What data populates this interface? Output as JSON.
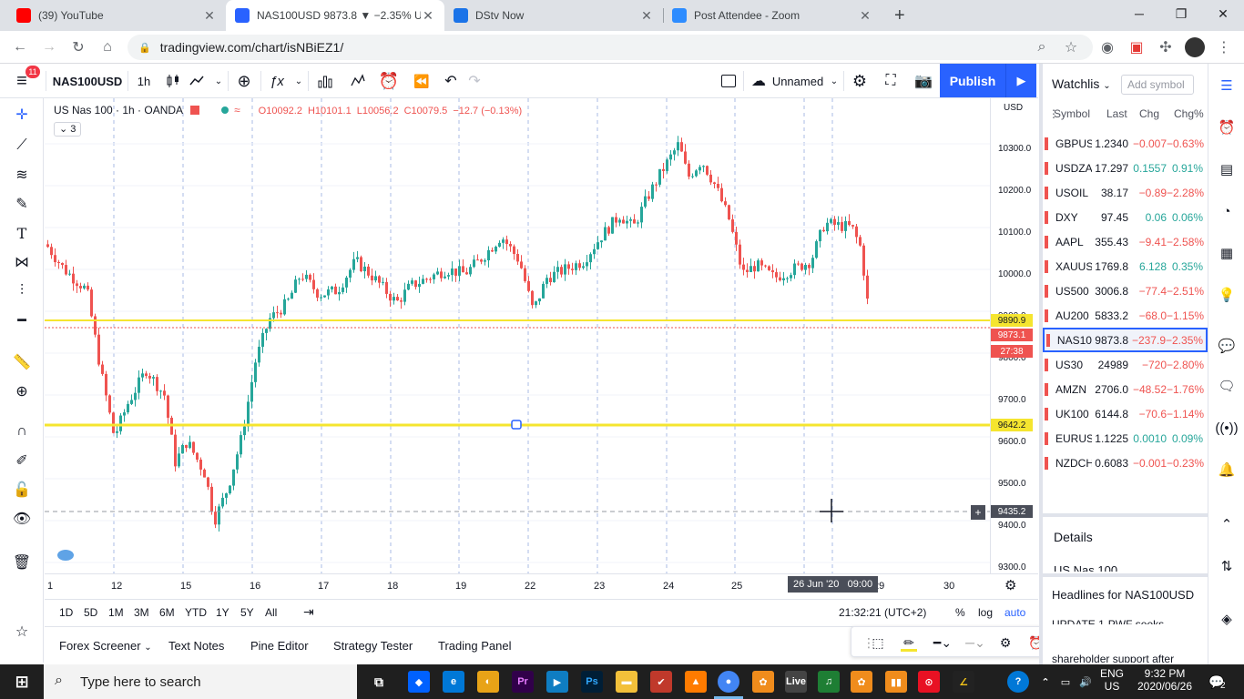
{
  "browser": {
    "tabs": [
      {
        "title": "(39) YouTube",
        "favicon_color": "#ff0000",
        "active": false
      },
      {
        "title": "NAS100USD 9873.8 ▼ −2.35% U",
        "favicon_color": "#2962ff",
        "active": true
      },
      {
        "title": "DStv Now",
        "favicon_color": "#1a73e8",
        "active": false
      },
      {
        "title": "Post Attendee - Zoom",
        "favicon_color": "#2d8cff",
        "active": false
      }
    ],
    "new_tab": "+",
    "url": "tradingview.com/chart/isNBiEZ1/"
  },
  "toolbar": {
    "notifications_badge": "11",
    "symbol": "NAS100USD",
    "interval": "1h",
    "layout_name": "Unnamed",
    "publish_label": "Publish"
  },
  "legend": {
    "title": "US Nas 100 · 1h · OANDA",
    "open": "O10092.2",
    "high": "H10101.1",
    "low": "L10056.2",
    "close": "C10079.5",
    "change": "−12.7 (−0.13%)",
    "indicator_count": "3"
  },
  "price_scale": {
    "currency": "USD",
    "labels": [
      "10300.0",
      "10200.0",
      "10100.0",
      "10000.0",
      "9900.0",
      "9800.0",
      "9700.0",
      "9600.0",
      "9500.0",
      "9400.0",
      "9300.0"
    ],
    "tags": {
      "line_upper": "9890.9",
      "last_price": "9873.1",
      "countdown": "27:38",
      "line_lower": "9642.2",
      "crosshair": "9435.2"
    }
  },
  "time_scale": {
    "labels": [
      "1",
      "12",
      "15",
      "16",
      "17",
      "18",
      "19",
      "22",
      "23",
      "24",
      "25",
      "29",
      "30"
    ],
    "crosshair_label": "26 Jun '20   09:00"
  },
  "range_bar": {
    "ranges": [
      "1D",
      "5D",
      "1M",
      "3M",
      "6M",
      "YTD",
      "1Y",
      "5Y",
      "All"
    ],
    "clock": "21:32:21 (UTC+2)",
    "percent": "%",
    "log": "log",
    "auto": "auto"
  },
  "bottom_tabs": [
    "Forex Screener",
    "Text Notes",
    "Pine Editor",
    "Strategy Tester",
    "Trading Panel"
  ],
  "watchlist": {
    "title": "Watchlis",
    "add_placeholder": "Add symbol",
    "columns": [
      "Symbol",
      "Last",
      "Chg",
      "Chg%"
    ],
    "rows": [
      {
        "symbol": "GBPUS",
        "last": "1.2340",
        "chg": "−0.007",
        "chgp": "−0.63%",
        "dir": "neg"
      },
      {
        "symbol": "USDZA",
        "last": "17.297",
        "chg": "0.1557",
        "chgp": "0.91%",
        "dir": "pos"
      },
      {
        "symbol": "USOIL",
        "last": "38.17",
        "chg": "−0.89",
        "chgp": "−2.28%",
        "dir": "neg"
      },
      {
        "symbol": "DXY",
        "last": "97.45",
        "chg": "0.06",
        "chgp": "0.06%",
        "dir": "pos"
      },
      {
        "symbol": "AAPL",
        "last": "355.43",
        "chg": "−9.41",
        "chgp": "−2.58%",
        "dir": "neg"
      },
      {
        "symbol": "XAUUS",
        "last": "1769.8",
        "chg": "6.128",
        "chgp": "0.35%",
        "dir": "pos"
      },
      {
        "symbol": "US500",
        "last": "3006.8",
        "chg": "−77.4",
        "chgp": "−2.51%",
        "dir": "neg"
      },
      {
        "symbol": "AU200",
        "last": "5833.2",
        "chg": "−68.0",
        "chgp": "−1.15%",
        "dir": "neg"
      },
      {
        "symbol": "NAS10",
        "last": "9873.8",
        "chg": "−237.9",
        "chgp": "−2.35%",
        "dir": "neg"
      },
      {
        "symbol": "US30",
        "last": "24989",
        "chg": "−720",
        "chgp": "−2.80%",
        "dir": "neg"
      },
      {
        "symbol": "AMZN",
        "last": "2706.0",
        "chg": "−48.52",
        "chgp": "−1.76%",
        "dir": "neg"
      },
      {
        "symbol": "UK100",
        "last": "6144.8",
        "chg": "−70.6",
        "chgp": "−1.14%",
        "dir": "neg"
      },
      {
        "symbol": "EURUS",
        "last": "1.1225",
        "chg": "0.0010",
        "chgp": "0.09%",
        "dir": "pos"
      },
      {
        "symbol": "NZDCH",
        "last": "0.6083",
        "chg": "−0.001",
        "chgp": "−0.23%",
        "dir": "neg"
      }
    ],
    "details_title": "Details",
    "details_sub": "US Nas 100",
    "headlines_title": "Headlines for NAS100USD",
    "headline_1": "UPDATE 1-PWF seeks",
    "headline_2": "shareholder support after"
  },
  "taskbar": {
    "search_placeholder": "Type here to search",
    "lang_top": "ENG",
    "lang_bottom": "US",
    "time": "9:32 PM",
    "date": "2020/06/26",
    "notif_count": "2"
  },
  "colors": {
    "up": "#26a69a",
    "down": "#ef5350",
    "hline": "#f5e52f",
    "accent": "#2962ff"
  }
}
